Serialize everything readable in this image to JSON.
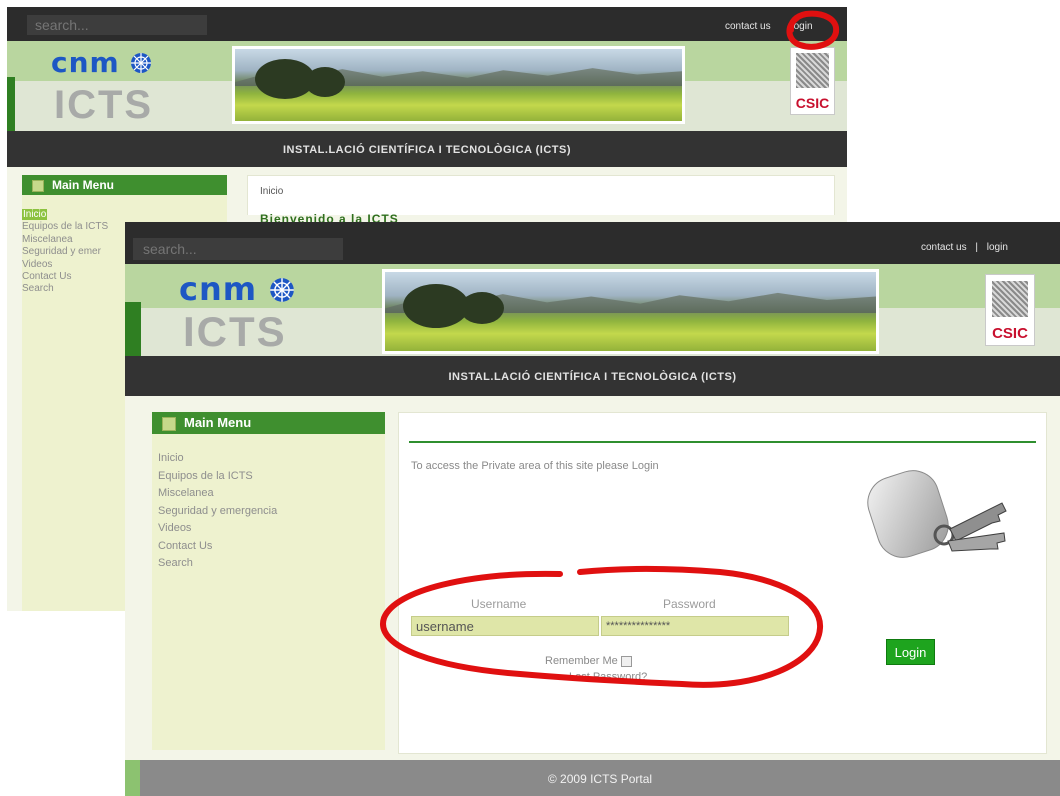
{
  "back": {
    "search_placeholder": "search...",
    "contact_label": "contact us",
    "login_label": "login",
    "logo_text": "cnm",
    "logo_sub": "ICTS",
    "csic_text": "CSIC",
    "title_bar": "INSTAL.LACIÓ CIENTÍFICA I TECNOLÒGICA (ICTS)",
    "menu_title": "Main Menu",
    "menu_items": [
      "Inicio",
      "Equipos de la ICTS",
      "Miscelanea",
      "Seguridad y emer",
      "Videos",
      "Contact Us",
      "Search"
    ],
    "breadcrumb": "Inicio",
    "welcome": "Bienvenido a la ICTS"
  },
  "front": {
    "search_placeholder": "search...",
    "contact_label": "contact us",
    "separator": "|",
    "login_label": "login",
    "logo_text": "cnm",
    "logo_sub": "ICTS",
    "csic_text": "CSIC",
    "title_bar": "INSTAL.LACIÓ CIENTÍFICA I TECNOLÒGICA (ICTS)",
    "menu_title": "Main Menu",
    "menu_items": [
      "Inicio",
      "Equipos de la ICTS",
      "Miscelanea",
      "Seguridad y emergencia",
      "Videos",
      "Contact Us",
      "Search"
    ],
    "login_intro": "To access the Private area of this site please Login",
    "username_label": "Username",
    "password_label": "Password",
    "username_value": "username",
    "password_value": "***************",
    "remember_label": "Remember Me",
    "lost_password": "Lost Password?",
    "login_button": "Login",
    "footer": "© 2009 ICTS Portal"
  },
  "colors": {
    "annotation": "#e01010",
    "accent_green": "#3f8f2f",
    "dark_bar": "#2c2c2c"
  }
}
